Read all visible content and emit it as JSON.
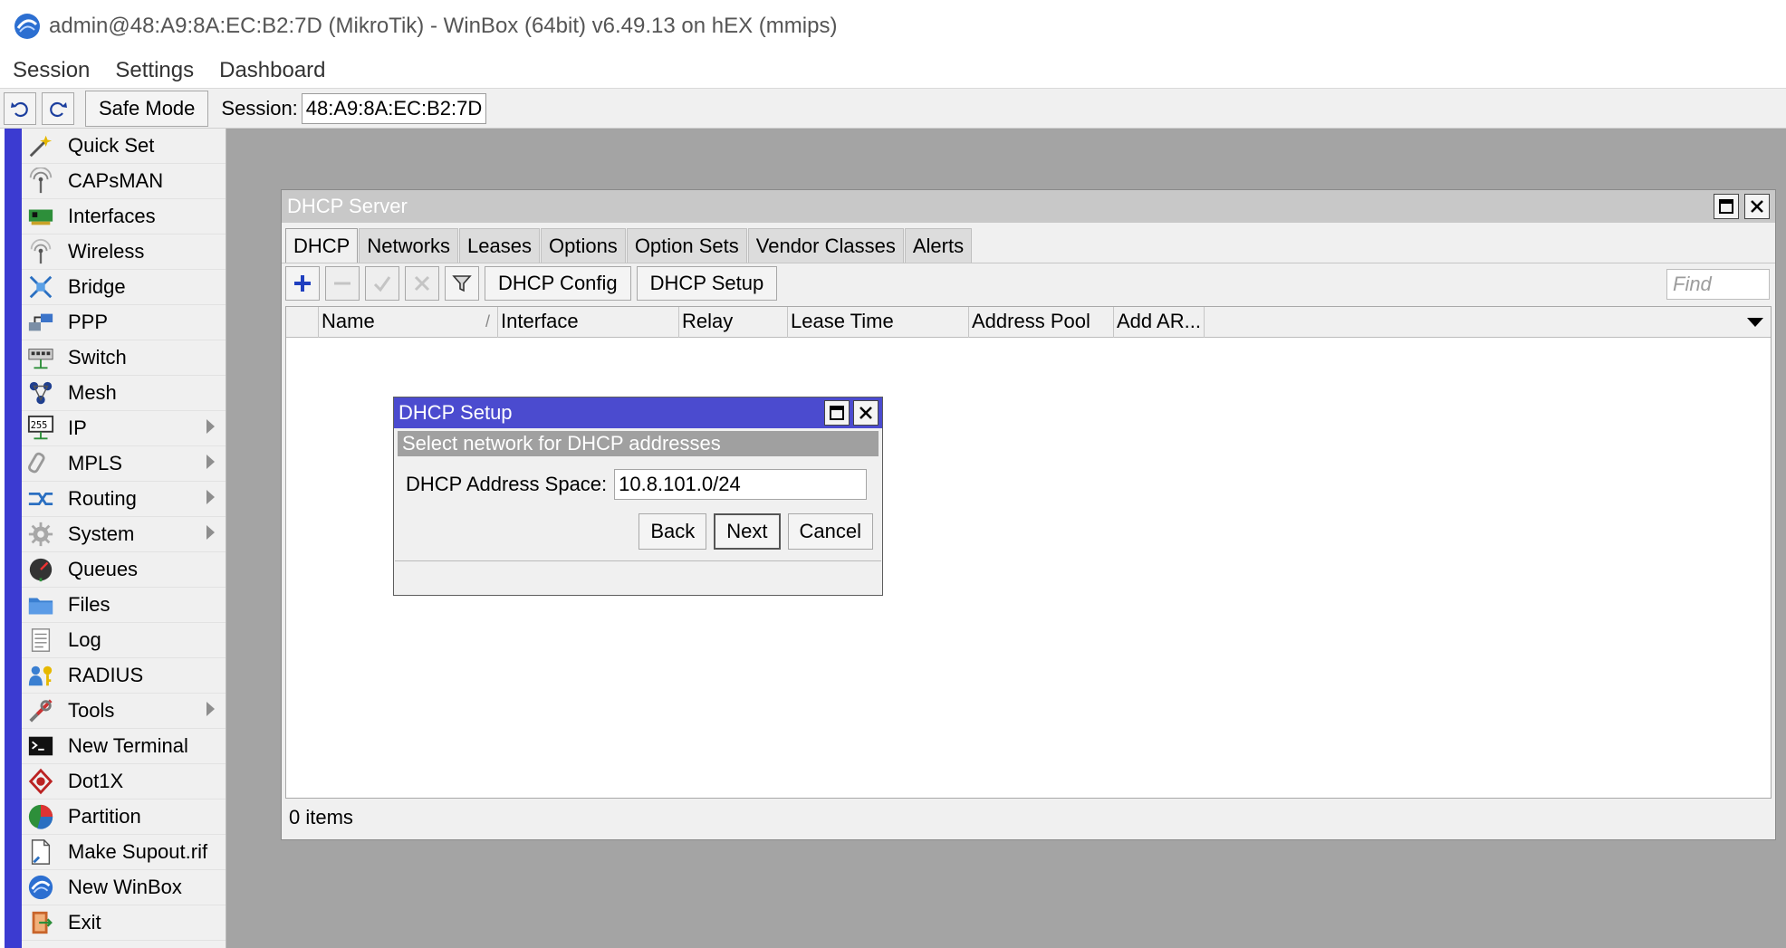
{
  "window": {
    "title": "admin@48:A9:8A:EC:B2:7D (MikroTik) - WinBox (64bit) v6.49.13 on hEX (mmips)"
  },
  "menu": [
    "Session",
    "Settings",
    "Dashboard"
  ],
  "toolbar": {
    "safe_mode_label": "Safe Mode",
    "session_label": "Session:",
    "session_value": "48:A9:8A:EC:B2:7D"
  },
  "sidebar": {
    "items": [
      {
        "label": "Quick Set",
        "icon": "wand-icon",
        "submenu": false
      },
      {
        "label": "CAPsMAN",
        "icon": "antenna-icon",
        "submenu": false
      },
      {
        "label": "Interfaces",
        "icon": "network-card-icon",
        "submenu": false
      },
      {
        "label": "Wireless",
        "icon": "wireless-icon",
        "submenu": false
      },
      {
        "label": "Bridge",
        "icon": "bridge-icon",
        "submenu": false
      },
      {
        "label": "PPP",
        "icon": "ppp-icon",
        "submenu": false
      },
      {
        "label": "Switch",
        "icon": "switch-icon",
        "submenu": false
      },
      {
        "label": "Mesh",
        "icon": "mesh-icon",
        "submenu": false
      },
      {
        "label": "IP",
        "icon": "ip-icon",
        "submenu": true
      },
      {
        "label": "MPLS",
        "icon": "mpls-icon",
        "submenu": true
      },
      {
        "label": "Routing",
        "icon": "routing-icon",
        "submenu": true
      },
      {
        "label": "System",
        "icon": "gear-icon",
        "submenu": true
      },
      {
        "label": "Queues",
        "icon": "gauge-icon",
        "submenu": false
      },
      {
        "label": "Files",
        "icon": "folder-icon",
        "submenu": false
      },
      {
        "label": "Log",
        "icon": "log-icon",
        "submenu": false
      },
      {
        "label": "RADIUS",
        "icon": "radius-icon",
        "submenu": false
      },
      {
        "label": "Tools",
        "icon": "tools-icon",
        "submenu": true
      },
      {
        "label": "New Terminal",
        "icon": "terminal-icon",
        "submenu": false
      },
      {
        "label": "Dot1X",
        "icon": "dot1x-icon",
        "submenu": false
      },
      {
        "label": "Partition",
        "icon": "pie-icon",
        "submenu": false
      },
      {
        "label": "Make Supout.rif",
        "icon": "document-icon",
        "submenu": false
      },
      {
        "label": "New WinBox",
        "icon": "winbox-icon",
        "submenu": false
      },
      {
        "label": "Exit",
        "icon": "exit-icon",
        "submenu": false
      }
    ]
  },
  "dhcp_window": {
    "title": "DHCP Server",
    "tabs": [
      "DHCP",
      "Networks",
      "Leases",
      "Options",
      "Option Sets",
      "Vendor Classes",
      "Alerts"
    ],
    "active_tab": "DHCP",
    "buttons": {
      "config": "DHCP Config",
      "setup": "DHCP Setup"
    },
    "find_placeholder": "Find",
    "columns": [
      "Name",
      "Interface",
      "Relay",
      "Lease Time",
      "Address Pool",
      "Add AR..."
    ],
    "status": "0 items"
  },
  "setup_dialog": {
    "title": "DHCP Setup",
    "banner": "Select network for DHCP addresses",
    "field_label": "DHCP Address Space:",
    "field_value": "10.8.101.0/24",
    "back_label": "Back",
    "next_label": "Next",
    "cancel_label": "Cancel"
  },
  "colors": {
    "sidebar_strip": "#3b3bd1",
    "dialog_title": "#4b4bcf",
    "workspace": "#a4a4a4",
    "add_button": "#1f3fbf"
  }
}
